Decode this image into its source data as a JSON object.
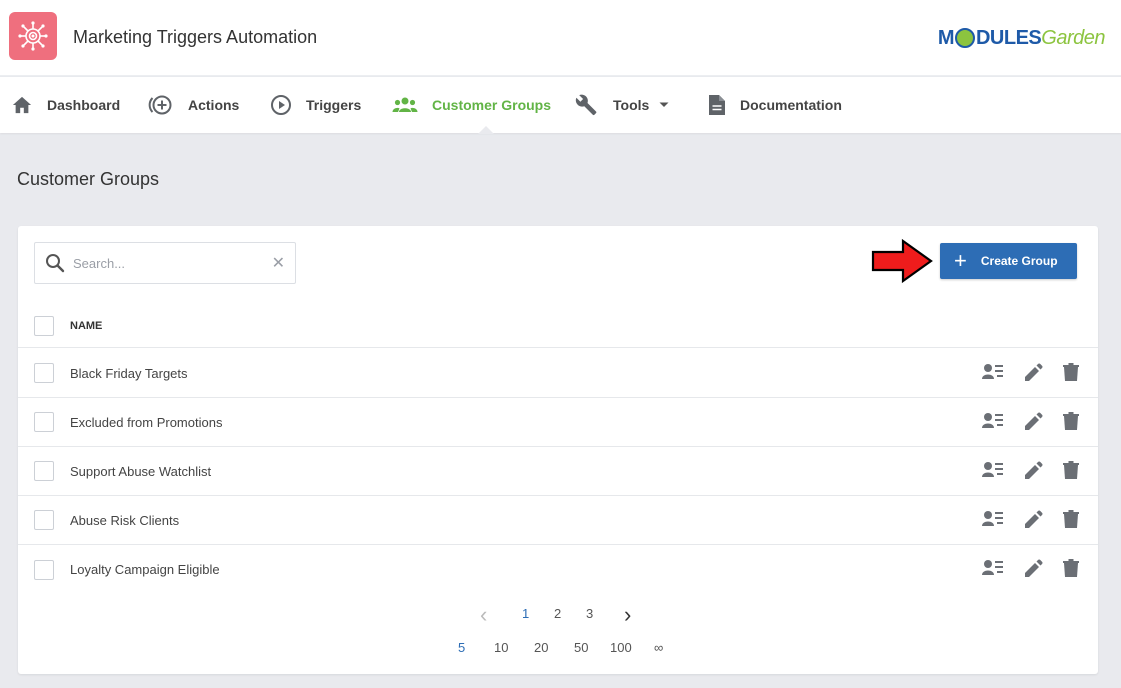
{
  "header": {
    "app_title": "Marketing Triggers Automation",
    "brand_part1": "M",
    "brand_part2": "DULES",
    "brand_part3": "Garden",
    "app_logo_icon": "target-network-icon",
    "accent": "#ef6f7e"
  },
  "nav": {
    "items": [
      {
        "label": "Dashboard",
        "icon": "home-icon"
      },
      {
        "label": "Actions",
        "icon": "plus-circle-icon"
      },
      {
        "label": "Triggers",
        "icon": "play-circle-icon"
      },
      {
        "label": "Customer Groups",
        "icon": "users-icon",
        "active": true
      },
      {
        "label": "Tools",
        "icon": "wrench-icon"
      },
      {
        "label": "Documentation",
        "icon": "document-icon"
      }
    ],
    "active_color": "#62b446"
  },
  "page": {
    "title": "Customer Groups"
  },
  "toolbar": {
    "search_placeholder": "Search...",
    "create_label": "Create Group",
    "button_color": "#2d6db5"
  },
  "table": {
    "column_name": "NAME",
    "rows": [
      {
        "name": "Black Friday Targets"
      },
      {
        "name": "Excluded from Promotions"
      },
      {
        "name": "Support Abuse Watchlist"
      },
      {
        "name": "Abuse Risk Clients"
      },
      {
        "name": "Loyalty Campaign Eligible"
      }
    ]
  },
  "pagination": {
    "prev": "‹",
    "next": "›",
    "pages": [
      "1",
      "2",
      "3"
    ],
    "current_page": "1",
    "sizes": [
      "5",
      "10",
      "20",
      "50",
      "100",
      "∞"
    ],
    "current_size": "5"
  }
}
